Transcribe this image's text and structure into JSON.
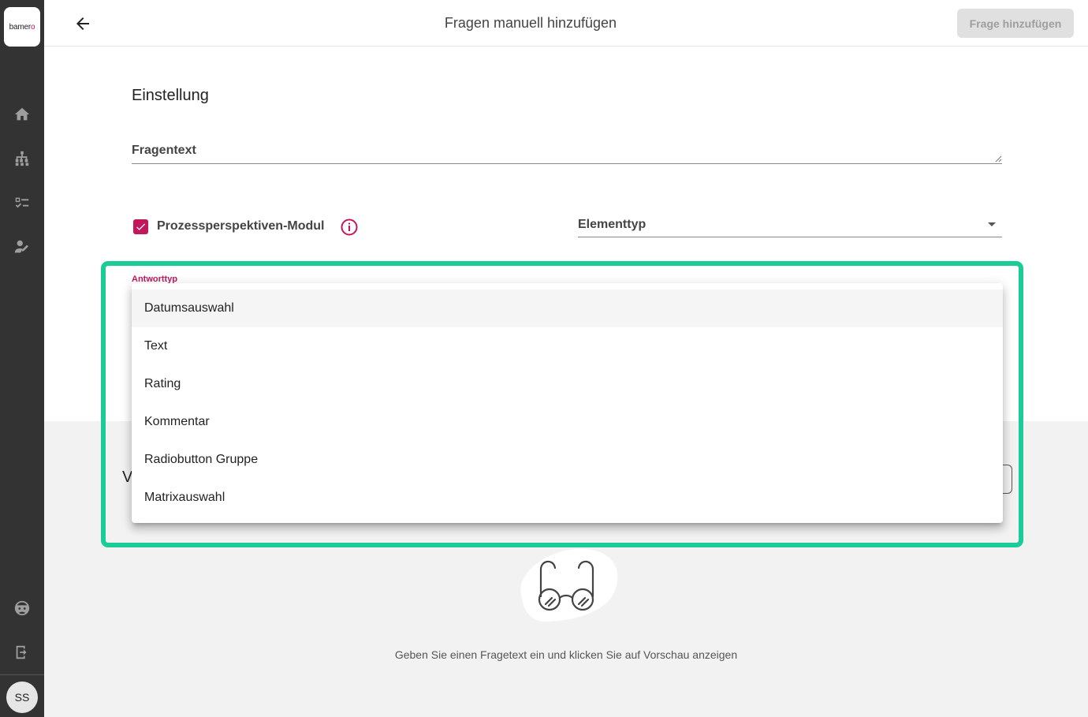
{
  "sidebar": {
    "logo_text": "bamer",
    "logo_accent": "o",
    "avatar_initials": "SS",
    "icons": [
      "home-icon",
      "org-chart-icon",
      "checklist-icon",
      "edit-user-icon",
      "support-icon",
      "logout-icon"
    ]
  },
  "header": {
    "title": "Fragen manuell hinzufügen",
    "add_button_label": "Frage hinzufügen"
  },
  "settings": {
    "section_title": "Einstellung",
    "question_text_label": "Fragentext",
    "process_module_label": "Prozessperspektiven-Modul",
    "process_module_checked": true,
    "element_type_label": "Elementtyp",
    "answer_type_label": "Antworttyp"
  },
  "answer_type_menu": {
    "items": [
      {
        "label": "Datumsauswahl",
        "highlighted": true
      },
      {
        "label": "Text"
      },
      {
        "label": "Rating"
      },
      {
        "label": "Kommentar"
      },
      {
        "label": "Radiobutton Gruppe"
      },
      {
        "label": "Matrixauswahl"
      }
    ]
  },
  "preview": {
    "title_partial": "V",
    "hint": "Geben Sie einen Fragetext ein und klicken Sie auf Vorschau anzeigen"
  },
  "colors": {
    "sidebar_bg": "#333333",
    "accent": "#c2185b",
    "highlight_frame": "#1ccc98",
    "preview_bg": "#f2f2f2"
  }
}
